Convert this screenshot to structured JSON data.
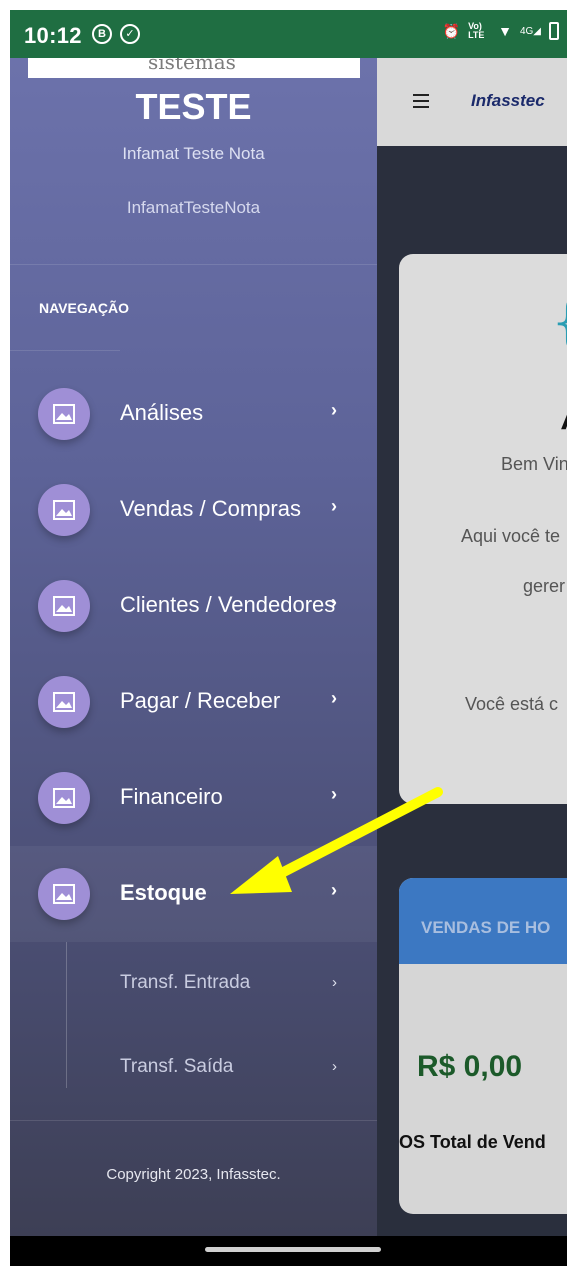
{
  "status_bar": {
    "time": "10:12",
    "icons": [
      "b-circle-icon",
      "shield-check-icon",
      "alarm-icon",
      "volte-icon",
      "wifi-icon",
      "signal-4g-icon",
      "battery-icon"
    ],
    "volte_text": "Vo) LTE",
    "net_text": "4G"
  },
  "app": {
    "brand": "Infasstec",
    "welcome_heading_fragment": "A",
    "welcome_lines": [
      "Bem Vin",
      "Aqui você te",
      "gerer",
      "Você está c"
    ],
    "sales_card": {
      "title": "VENDAS DE HO",
      "value": "R$ 0,00",
      "label": "Total de Vend",
      "label_prefix": "OS"
    }
  },
  "drawer": {
    "logo_text": "sistemas",
    "org_title": "TESTE",
    "org_subtitle": "Infamat Teste Nota",
    "username": "InfamatTesteNota",
    "nav_heading": "NAVEGAÇÃO",
    "items": [
      {
        "label": "Análises",
        "chevron": "›"
      },
      {
        "label": "Vendas / Compras",
        "chevron": "›"
      },
      {
        "label": "Clientes / Vendedores",
        "chevron": "›"
      },
      {
        "label": "Pagar / Receber",
        "chevron": "›"
      },
      {
        "label": "Financeiro",
        "chevron": "›"
      },
      {
        "label": "Estoque",
        "chevron": "›"
      }
    ],
    "sub_items": [
      {
        "label": "Transf. Entrada",
        "chevron": "›"
      },
      {
        "label": "Transf. Saída",
        "chevron": "›"
      }
    ],
    "copyright": "Copyright 2023, Infasstec."
  },
  "colors": {
    "status_bar": "#1f6e42",
    "drawer_top": "#6c72ab",
    "drawer_bottom": "#3d3f55",
    "nav_icon": "#9f8fd6",
    "annotation_arrow": "#ffff00",
    "sales_header": "#3c78c2",
    "sales_value": "#1c5a2a"
  }
}
